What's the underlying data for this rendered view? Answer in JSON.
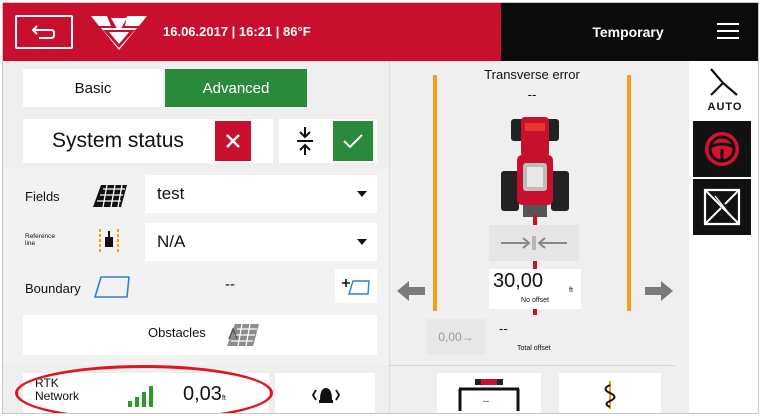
{
  "topbar": {
    "info": "16.06.2017 | 16:21 | 86°F",
    "mode": "Temporary",
    "colors": {
      "red": "#c8102e",
      "black": "#0b0b0b"
    }
  },
  "tabs": {
    "basic": "Basic",
    "advanced": "Advanced",
    "active": "Advanced"
  },
  "system_status": {
    "label": "System status"
  },
  "fields": {
    "label": "Fields",
    "value": "test"
  },
  "reference_line": {
    "label": "Reference line",
    "value": "N/A"
  },
  "boundary": {
    "label": "Boundary",
    "value": "--"
  },
  "obstacles": {
    "label": "Obstacles"
  },
  "rtk": {
    "label": "RTK Network",
    "value": "0,03",
    "unit": "ft"
  },
  "transverse_error": {
    "title": "Transverse error",
    "value": "--"
  },
  "offset": {
    "value": "30,00",
    "unit": "ft",
    "sub": "No offset"
  },
  "total_offset": {
    "button": "0,00→",
    "value": "--",
    "label": "Total offset"
  },
  "bottom_center": {
    "value": "--"
  },
  "right_column": {
    "auto_label": "AUTO"
  }
}
